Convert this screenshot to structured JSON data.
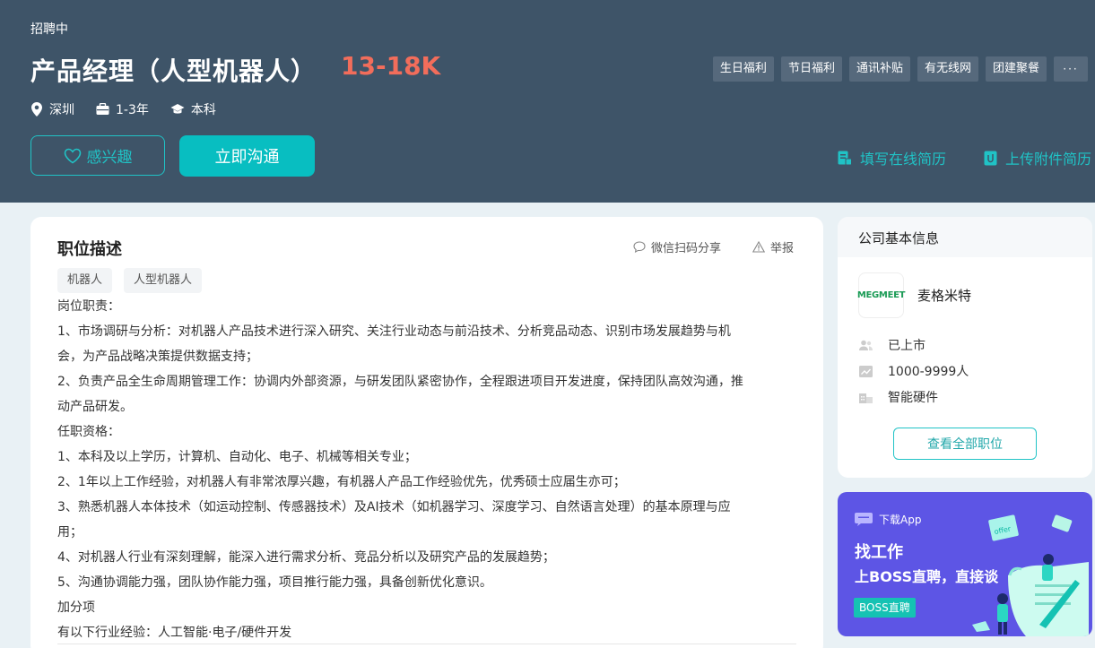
{
  "job": {
    "status": "招聘中",
    "title": "产品经理（人型机器人）",
    "salary": "13-18K",
    "city": "深圳",
    "experience": "1-3年",
    "degree": "本科"
  },
  "welfare": [
    "生日福利",
    "节日福利",
    "通讯补贴",
    "有无线网",
    "团建聚餐"
  ],
  "welfare_more": "···",
  "actions": {
    "interest": "感兴趣",
    "chat": "立即沟通",
    "online_resume": "填写在线简历",
    "upload_resume": "上传附件简历"
  },
  "description": {
    "title": "职位描述",
    "share": "微信扫码分享",
    "report": "举报",
    "keywords": [
      "机器人",
      "人型机器人"
    ],
    "lines": [
      "岗位职责：",
      "1、市场调研与分析：对机器人产品技术进行深入研究、关注行业动态与前沿技术、分析竞品动态、识别市场发展趋势与机",
      "会，为产品战略决策提供数据支持；",
      "2、负责产品全生命周期管理工作：协调内外部资源，与研发团队紧密协作，全程跟进项目开发进度，保持团队高效沟通，推",
      "动产品研发。",
      "任职资格：",
      "1、本科及以上学历，计算机、自动化、电子、机械等相关专业；",
      "2、1年以上工作经验，对机器人有非常浓厚兴趣，有机器人产品工作经验优先，优秀硕士应届生亦可；",
      "3、熟悉机器人本体技术（如运动控制、传感器技术）及AI技术（如机器学习、深度学习、自然语言处理）的基本原理与应",
      "用；",
      "4、对机器人行业有深刻理解，能深入进行需求分析、竞品分析以及研究产品的发展趋势；",
      "5、沟通协调能力强，团队协作能力强，项目推行能力强，具备创新优化意识。",
      "加分项",
      "有以下行业经验：人工智能·电子/硬件开发"
    ]
  },
  "company": {
    "section_title": "公司基本信息",
    "logo_text": "MEGMEET",
    "name": "麦格米特",
    "stage": "已上市",
    "size": "1000-9999人",
    "industry": "智能硬件",
    "all_jobs": "查看全部职位"
  },
  "app_promo": {
    "download": "下载App",
    "title": "找工作",
    "subtitle": "上BOSS直聘，直接谈",
    "badge": "BOSS直聘",
    "offer_text": "offer"
  },
  "colors": {
    "banner_bg": "#3e5468",
    "salary": "#f26d5b",
    "accent": "#08bec1",
    "app_bg": "#5d55e5"
  }
}
